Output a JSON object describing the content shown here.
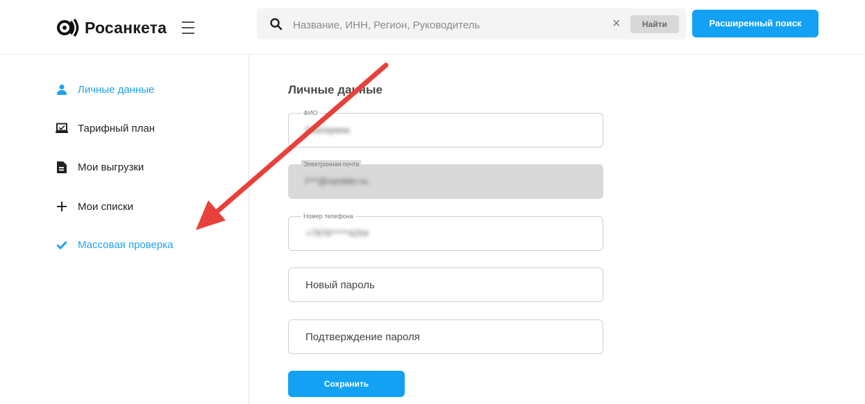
{
  "header": {
    "logo_text": "Росанкета",
    "search": {
      "placeholder": "Название, ИНН, Регион, Руководитель",
      "clear_symbol": "×",
      "find_label": "Найти"
    },
    "advanced_search_label": "Расширенный поиск"
  },
  "sidebar": {
    "items": [
      {
        "label": "Личные данные",
        "icon": "user-icon",
        "active": true
      },
      {
        "label": "Тарифный план",
        "icon": "laptop-icon",
        "active": false
      },
      {
        "label": "Мои выгрузки",
        "icon": "document-icon",
        "active": false
      },
      {
        "label": "Мои списки",
        "icon": "plus-icon",
        "active": false
      },
      {
        "label": "Массовая проверка",
        "icon": "checkmark-icon",
        "active": true
      }
    ]
  },
  "main": {
    "title": "Личные данные",
    "fields": {
      "name": {
        "label": "ФИО",
        "value": "Екатерина"
      },
      "email": {
        "label": "Электронная почта",
        "value": "l***@rambler.ru"
      },
      "phone": {
        "label": "Номер телефона",
        "value": "+7976*****4254"
      },
      "new_password": {
        "placeholder": "Новый пароль"
      },
      "confirm_password": {
        "placeholder": "Подтверждение пароля"
      }
    },
    "save_label": "Сохранить"
  },
  "colors": {
    "accent": "#13a2f3",
    "active_text": "#1fa2f0",
    "annotation_arrow": "#e8403a"
  }
}
